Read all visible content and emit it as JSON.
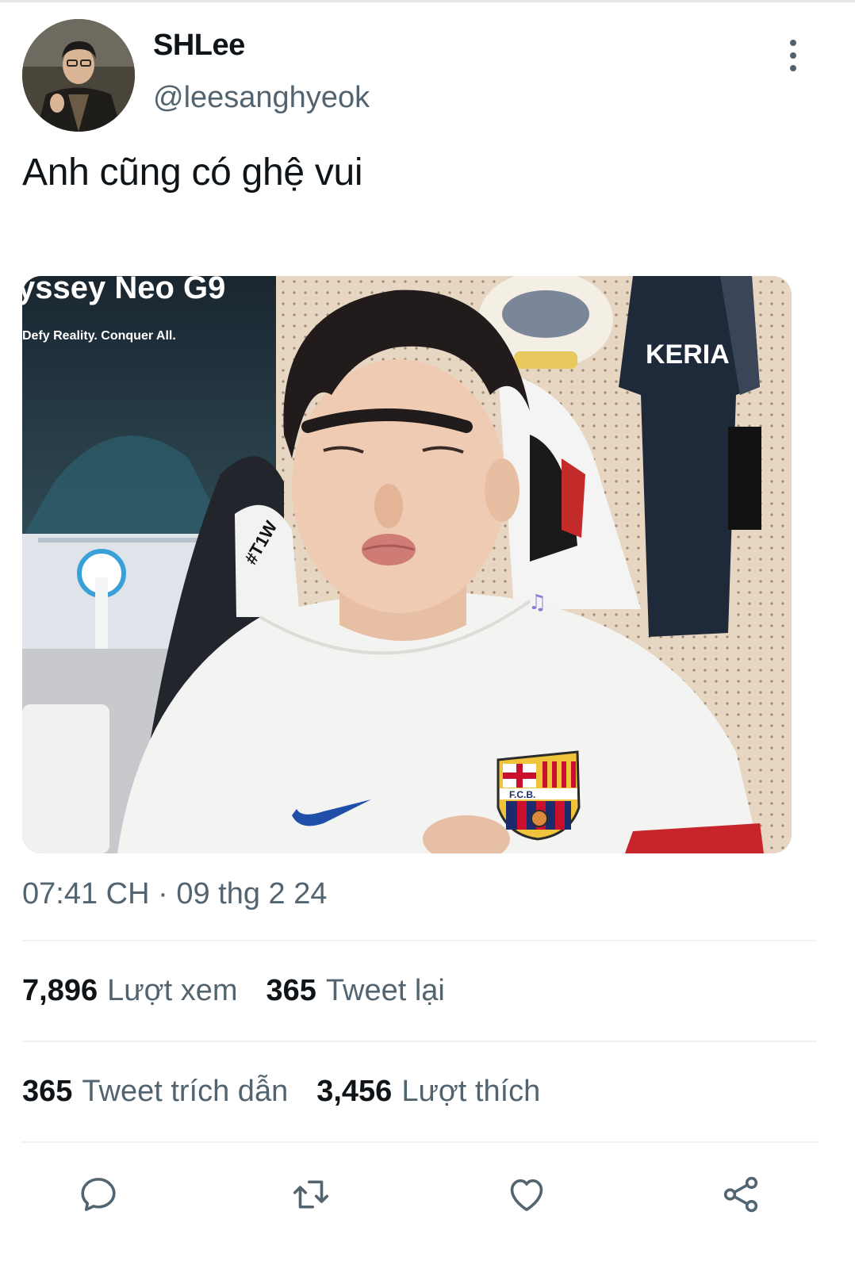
{
  "user": {
    "display_name": "SHLee",
    "handle": "@leesanghyeok"
  },
  "tweet": {
    "text": "Anh cũng có ghệ vui",
    "time": "07:41 CH",
    "separator": "·",
    "date": "09 thg 2 24"
  },
  "media": {
    "monitor_brand": "yssey Neo G9",
    "monitor_tagline": "Defy Reality. Conquer All.",
    "jersey_name": "KERIA",
    "chair_text": "#T1W",
    "crest_text": "F.C.B."
  },
  "stats": {
    "views_value": "7,896",
    "views_label": "Lượt xem",
    "retweets_value": "365",
    "retweets_label": "Tweet lại",
    "quotes_value": "365",
    "quotes_label": "Tweet trích dẫn",
    "likes_value": "3,456",
    "likes_label": "Lượt thích"
  },
  "icons": {
    "reply": "reply-icon",
    "retweet": "retweet-icon",
    "like": "heart-icon",
    "share": "share-icon",
    "more": "more-vertical-icon"
  },
  "colors": {
    "text_primary": "#0f1419",
    "text_secondary": "#536471",
    "divider": "#eff3f4"
  }
}
